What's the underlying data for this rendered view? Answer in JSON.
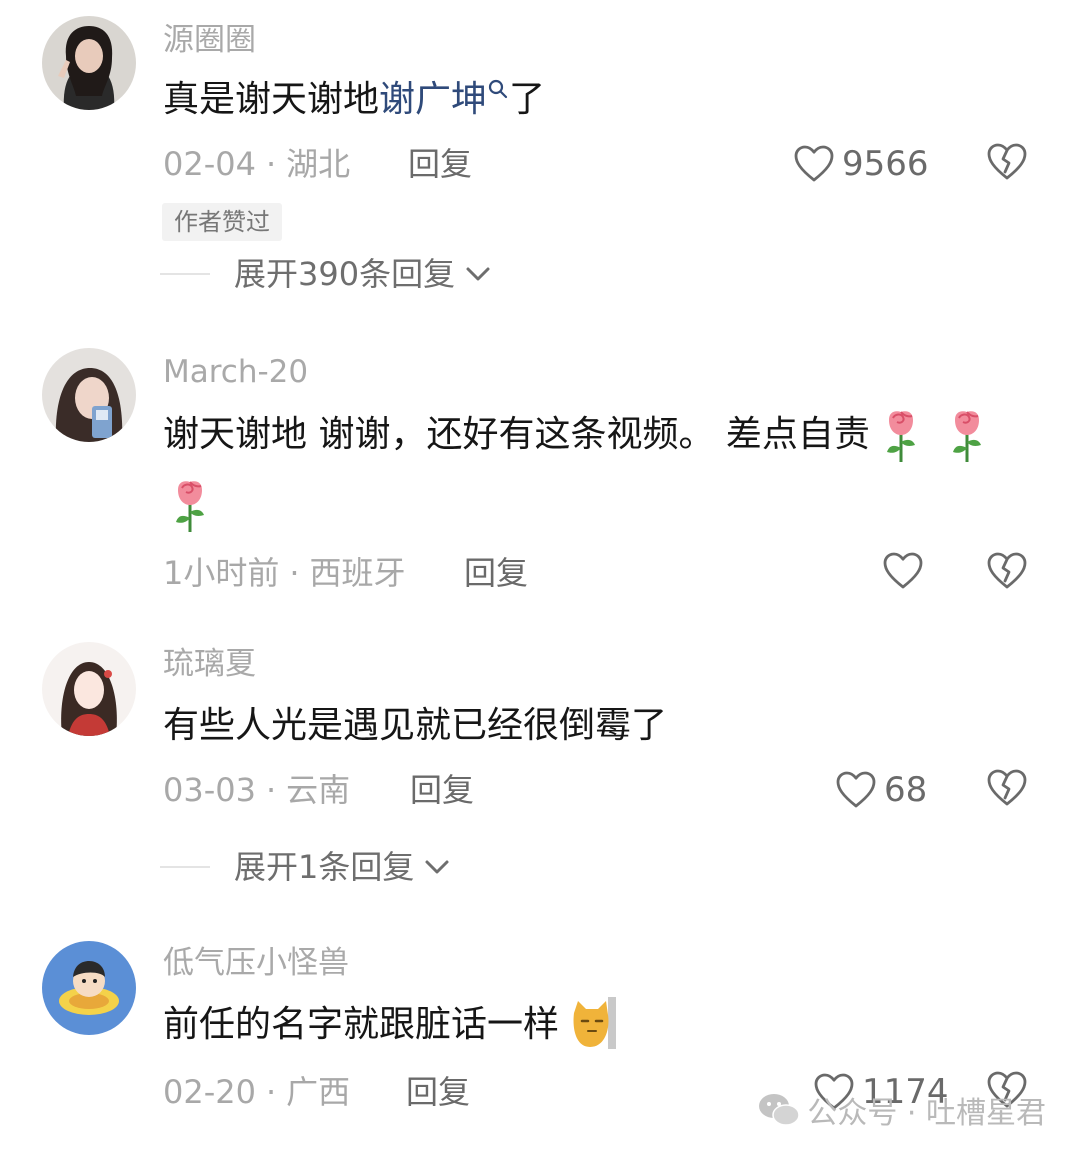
{
  "comments": [
    {
      "username": "源圈圈",
      "text_before": "真是谢天谢地",
      "text_link": "谢广坤",
      "text_after": "了",
      "date": "02-04",
      "location": "湖北",
      "reply_label": "回复",
      "likes": "9566",
      "badge": "作者赞过",
      "expand_label": "展开390条回复"
    },
    {
      "username": "March-20",
      "text_line1": "谢天谢地 谢谢，还好有这条视频。 差点自责",
      "date": "1小时前",
      "location": "西班牙",
      "reply_label": "回复",
      "likes": ""
    },
    {
      "username": "琉璃夏",
      "text": "有些人光是遇见就已经很倒霉了",
      "date": "03-03",
      "location": "云南",
      "reply_label": "回复",
      "likes": "68",
      "expand_label": "展开1条回复"
    },
    {
      "username": "低气压小怪兽",
      "text": "前任的名字就跟脏话一样",
      "date": "02-20",
      "location": "广西",
      "reply_label": "回复",
      "likes": "1174"
    }
  ],
  "separator": "·",
  "watermark": "公众号 · 吐槽星君",
  "icons": {
    "like": "heart-outline-icon",
    "dislike": "broken-heart-icon",
    "expand": "chevron-down-icon",
    "search": "search-icon",
    "emoji_rose": "rose-emoji",
    "emoji_cat": "cat-emoji",
    "watermark": "wechat-icon"
  },
  "colors": {
    "link": "#2f4a7a",
    "username": "#a9a9a9",
    "text": "#161616"
  }
}
